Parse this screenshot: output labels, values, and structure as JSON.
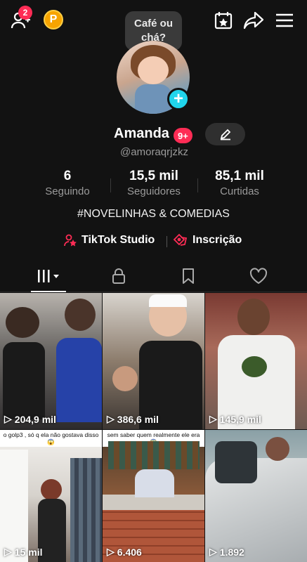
{
  "topbar": {
    "friends_badge": "2",
    "coin_letter": "P",
    "icons": [
      "add-friend-icon",
      "coin-icon",
      "calendar-star-icon",
      "share-icon",
      "menu-icon"
    ]
  },
  "bubble": {
    "text": "Café ou chá?"
  },
  "profile": {
    "name": "Amanda",
    "badge": "9+",
    "handle": "@amoraqrjzkz",
    "bio": "#NOVELINHAS & COMEDIAS"
  },
  "stats": [
    {
      "value": "6",
      "label": "Seguindo"
    },
    {
      "value": "15,5 mil",
      "label": "Seguidores"
    },
    {
      "value": "85,1 mil",
      "label": "Curtidas"
    }
  ],
  "links": {
    "studio": "TikTok Studio",
    "subscription": "Inscrição"
  },
  "tabs": [
    "videos-grid",
    "private",
    "saved",
    "liked"
  ],
  "videos": [
    {
      "views": "204,9 mil",
      "caption": ""
    },
    {
      "views": "386,6 mil",
      "caption": ""
    },
    {
      "views": "145,9 mil",
      "caption": ""
    },
    {
      "views": "15 mil",
      "caption": "o golp3 , só q ela não gostava disso 😱"
    },
    {
      "views": "6.406",
      "caption": "sem saber quem realmente ele era 😱"
    },
    {
      "views": "1.892",
      "caption": ""
    }
  ],
  "colors": {
    "accent_pink": "#fe2c55",
    "accent_cyan": "#20d5ec",
    "background": "#121212",
    "muted_text": "#9a9a9a"
  }
}
